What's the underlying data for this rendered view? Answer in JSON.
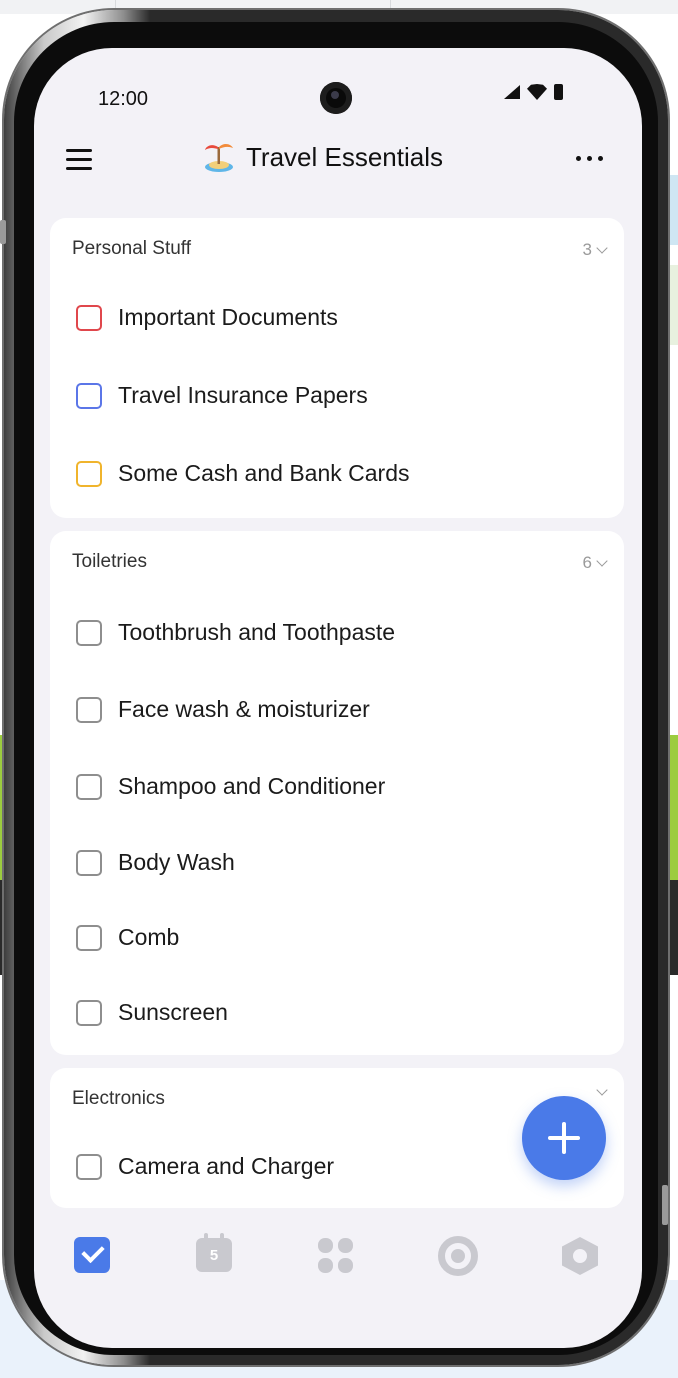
{
  "status_bar": {
    "time": "12:00"
  },
  "header": {
    "title": "Travel Essentials",
    "title_icon": "beach-island-icon",
    "menu_icon": "hamburger-menu-icon",
    "more_icon": "more-dots-icon"
  },
  "sections": [
    {
      "name": "Personal Stuff",
      "count": "3",
      "items": [
        {
          "label": "Important Documents",
          "checked": false,
          "color": "#e0474c"
        },
        {
          "label": "Travel Insurance Papers",
          "checked": false,
          "color": "#5b76e8"
        },
        {
          "label": "Some Cash and Bank Cards",
          "checked": false,
          "color": "#f0b42c"
        }
      ]
    },
    {
      "name": "Toiletries",
      "count": "6",
      "items": [
        {
          "label": "Toothbrush and Toothpaste",
          "checked": false
        },
        {
          "label": "Face wash & moisturizer",
          "checked": false
        },
        {
          "label": "Shampoo and Conditioner",
          "checked": false
        },
        {
          "label": "Body Wash",
          "checked": false
        },
        {
          "label": "Comb",
          "checked": false
        },
        {
          "label": "Sunscreen",
          "checked": false
        }
      ]
    },
    {
      "name": "Electronics",
      "items": [
        {
          "label": "Camera and Charger",
          "checked": false
        }
      ]
    }
  ],
  "fab": {
    "icon": "plus-icon"
  },
  "bottom_nav": [
    {
      "name": "tasks",
      "icon": "checkbox-icon",
      "active": true
    },
    {
      "name": "calendar",
      "icon": "calendar-icon",
      "badge": "5",
      "active": false
    },
    {
      "name": "apps",
      "icon": "grid-icon",
      "active": false
    },
    {
      "name": "focus",
      "icon": "target-icon",
      "active": false
    },
    {
      "name": "settings",
      "icon": "hexagon-settings-icon",
      "active": false
    }
  ],
  "colors": {
    "accent": "#4a7ae8",
    "background": "#f3f2f7",
    "card": "#ffffff"
  }
}
